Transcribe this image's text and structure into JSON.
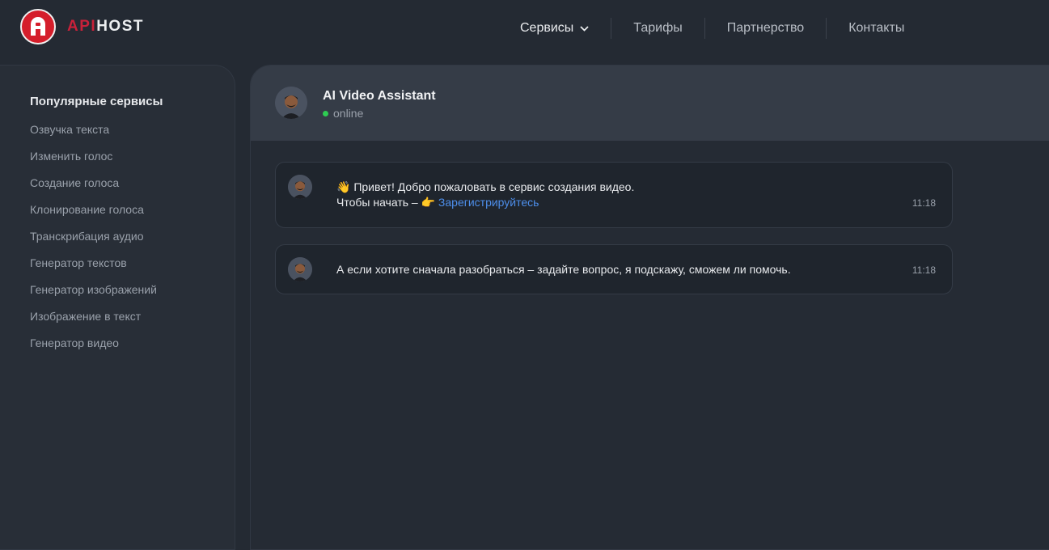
{
  "header": {
    "logo_api": "API",
    "logo_host": "HOST",
    "nav": [
      {
        "label": "Сервисы"
      },
      {
        "label": "Тарифы"
      },
      {
        "label": "Партнерство"
      },
      {
        "label": "Контакты"
      }
    ]
  },
  "sidebar": {
    "title": "Популярные сервисы",
    "items": [
      {
        "label": "Озвучка текста"
      },
      {
        "label": "Изменить голос"
      },
      {
        "label": "Создание голоса"
      },
      {
        "label": "Клонирование голоса"
      },
      {
        "label": "Транскрибация аудио"
      },
      {
        "label": "Генератор текстов"
      },
      {
        "label": "Генератор изображений"
      },
      {
        "label": "Изображение в текст"
      },
      {
        "label": "Генератор видео"
      }
    ]
  },
  "chat": {
    "assistant_name": "AI Video Assistant",
    "status": "online",
    "messages": [
      {
        "line1": "👋 Привет! Добро пожаловать в сервис создания видео.",
        "line2_prefix": "Чтобы начать – 👉 ",
        "link": "Зарегистрируйтесь",
        "time": "11:18"
      },
      {
        "text": "А если хотите сначала разобраться – задайте вопрос, я подскажу, сможем ли помочь.",
        "time": "11:18"
      }
    ]
  },
  "colors": {
    "brand_red": "#d51e2b",
    "online": "#2ecc52",
    "link": "#4d8eea"
  }
}
